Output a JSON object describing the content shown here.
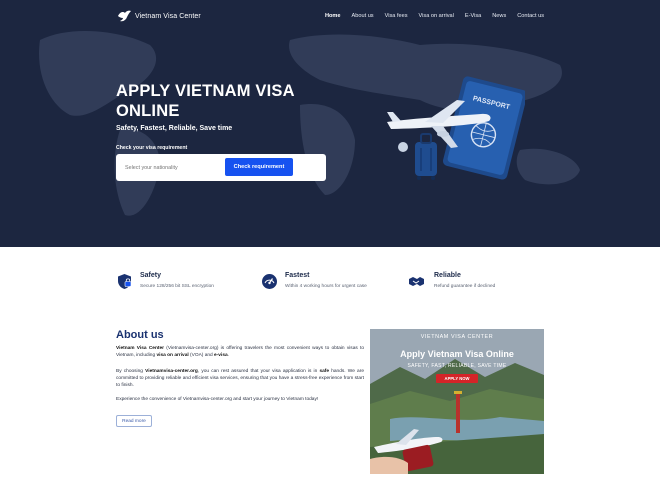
{
  "nav": {
    "logo_text": "Vietnam Visa Center",
    "items": [
      {
        "label": "Home"
      },
      {
        "label": "About us"
      },
      {
        "label": "Visa fees"
      },
      {
        "label": "Visa on arrival"
      },
      {
        "label": "E-Visa"
      },
      {
        "label": "News"
      },
      {
        "label": "Contact us"
      }
    ]
  },
  "hero": {
    "title": "APPLY VIETNAM VISA ONLINE",
    "subtitle": "Safety, Fastest, Reliable, Save time",
    "check_label": "Check your visa requirement",
    "nationality_placeholder": "Select your nationality",
    "check_button": "Check requirement",
    "passport_text": "PASSPORT"
  },
  "features": [
    {
      "title": "Safety",
      "desc": "Secure 128/256 bit SSL encryption",
      "icon": "shield-lock-icon"
    },
    {
      "title": "Fastest",
      "desc": "Within 4 working hours for urgent case",
      "icon": "speedometer-icon"
    },
    {
      "title": "Reliable",
      "desc": "Refund guarantee if declined",
      "icon": "handshake-icon"
    }
  ],
  "about": {
    "title": "About us",
    "p1_a": "Vietnam Visa Center",
    "p1_b": " (Vietnamvisa-center.org) is offering travelers the most convenient ways to obtain visas to Vietnam, including ",
    "p1_c": "visa on arrival",
    "p1_d": " (VOA) and ",
    "p1_e": "e-visa",
    "p1_f": ".",
    "p2_a": "By choosing ",
    "p2_b": "Vietnamvisa-center.org",
    "p2_c": ", you can rest assured that your visa application is in ",
    "p2_d": "safe",
    "p2_e": " hands. We are committed to providing reliable and efficient visa services, ensuring that you have a stress-free experience from start to finish.",
    "p3": "Experience the convenience of Vietnamvisa-center.org and start your journey to Vietnam today!",
    "read_more": "Read more"
  },
  "promo": {
    "brand": "VIETNAM VISA CENTER",
    "title": "Apply Vietnam Visa Online",
    "tagline": "SAFETY, FAST, RELIABLE, SAVE TIME",
    "apply_button": "APPLY NOW"
  },
  "colors": {
    "hero_bg": "#1c2640",
    "accent_blue": "#1652f0",
    "heading_blue": "#1a3270",
    "apply_red": "#d42428"
  }
}
